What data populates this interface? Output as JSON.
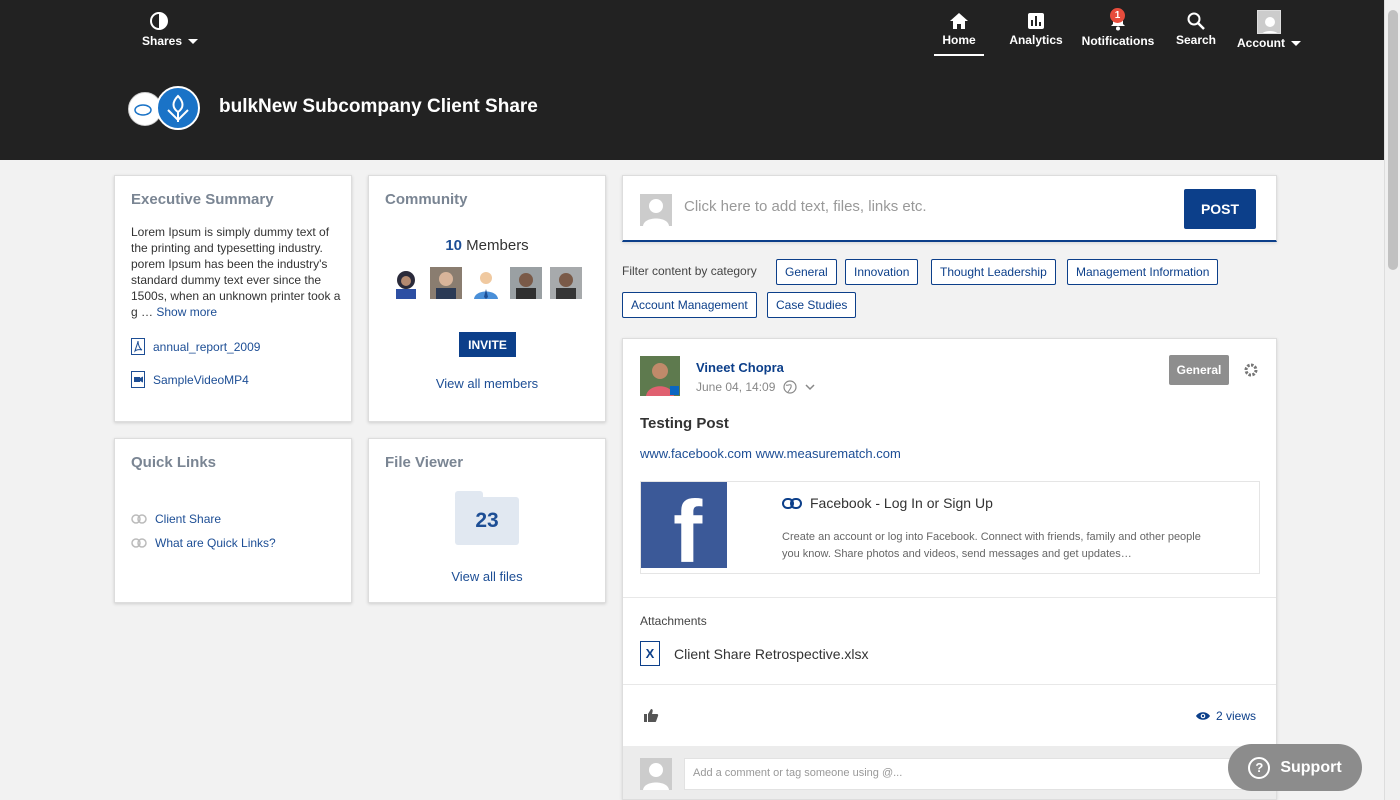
{
  "header": {
    "shares_label": "Shares",
    "share_title": "bulkNew Subcompany Client Share",
    "nav": [
      {
        "label": "Home",
        "icon": "home-icon",
        "active": true
      },
      {
        "label": "Analytics",
        "icon": "analytics-icon"
      },
      {
        "label": "Notifications",
        "icon": "bell-icon",
        "badge": "1"
      },
      {
        "label": "Search",
        "icon": "search-icon"
      },
      {
        "label": "Account",
        "icon": "account-avatar"
      }
    ]
  },
  "executive_summary": {
    "title": "Executive Summary",
    "text": "Lorem Ipsum is simply dummy text of the printing and typesetting industry. porem Ipsum has been the industry's standard dummy text ever since the 1500s, when an unknown printer took a g …",
    "show_more": "Show more",
    "files": [
      {
        "name": "annual_report_2009",
        "icon": "pdf-icon"
      },
      {
        "name": "SampleVideoMP4",
        "icon": "video-icon"
      }
    ]
  },
  "community": {
    "title": "Community",
    "member_count": "10",
    "members_word": "Members",
    "invite_label": "INVITE",
    "view_all": "View all members"
  },
  "quick_links": {
    "title": "Quick Links",
    "items": [
      "Client Share",
      "What are Quick Links?"
    ]
  },
  "file_viewer": {
    "title": "File Viewer",
    "count": "23",
    "view_all": "View all files"
  },
  "composer": {
    "placeholder": "Click here to add text, files, links etc.",
    "post_label": "POST"
  },
  "filter": {
    "label": "Filter content by category",
    "categories": [
      "General",
      "Innovation",
      "Thought Leadership",
      "Management Information",
      "Account Management",
      "Case Studies"
    ]
  },
  "post": {
    "author": "Vineet Chopra",
    "date": "June 04, 14:09",
    "category": "General",
    "title": "Testing Post",
    "links_text": "www.facebook.com www.measurematch.com",
    "preview": {
      "title": "Facebook - Log In or Sign Up",
      "description": "Create an account or log into Facebook. Connect with friends, family and other people you know. Share photos and videos, send messages and get updates…"
    },
    "attachments_label": "Attachments",
    "attachment_name": "Client Share Retrospective.xlsx",
    "views": "2 views",
    "comment_placeholder": "Add a comment or tag someone using @..."
  },
  "support": {
    "label": "Support"
  },
  "colors": {
    "header_bg": "#222222",
    "primary": "#0c3f8a",
    "page_bg": "#f2f2f2",
    "badge_red": "#e74c3c",
    "facebook_blue": "#3b5998"
  }
}
